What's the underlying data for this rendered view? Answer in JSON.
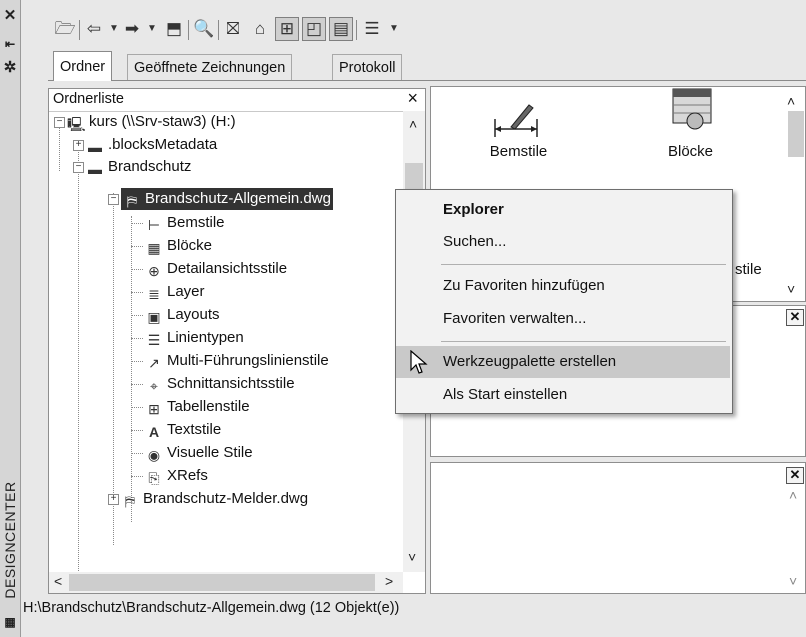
{
  "sidebar": {
    "title": "DESIGNCENTER",
    "icons": [
      "close-icon",
      "auto-hide-icon",
      "properties-icon"
    ]
  },
  "toolbar": {
    "icons": [
      "load-icon",
      "back-icon",
      "back-dropdown-icon",
      "forward-icon",
      "forward-dropdown-icon",
      "up-icon",
      "search-icon",
      "favorites-icon",
      "home-icon",
      "tree-view-toggle-icon",
      "preview-icon",
      "description-icon",
      "views-icon",
      "views-dropdown-icon"
    ]
  },
  "tabs": [
    "Ordner",
    "Geöffnete Zeichnungen",
    "Protokoll"
  ],
  "tree": {
    "header": "Ordnerliste",
    "close": "×",
    "items": [
      {
        "label": "kurs (\\\\Srv-staw3) (H:)",
        "icon": "network-drive-icon"
      },
      {
        "label": ".blocksMetadata",
        "icon": "folder-icon"
      },
      {
        "label": "Brandschutz",
        "icon": "folder-icon"
      },
      {
        "label": "Brandschutz-Allgemein.dwg",
        "icon": "drawing-file-icon"
      },
      {
        "label": "Bemstile",
        "icon": "dimstyle-icon"
      },
      {
        "label": "Blöcke",
        "icon": "blocks-icon"
      },
      {
        "label": "Detailansichtsstile",
        "icon": "detail-view-style-icon"
      },
      {
        "label": "Layer",
        "icon": "layer-icon"
      },
      {
        "label": "Layouts",
        "icon": "layout-icon"
      },
      {
        "label": "Linientypen",
        "icon": "linetype-icon"
      },
      {
        "label": "Multi-Führungslinienstile",
        "icon": "multileader-icon"
      },
      {
        "label": "Schnittansichtsstile",
        "icon": "section-view-style-icon"
      },
      {
        "label": "Tabellenstile",
        "icon": "table-style-icon"
      },
      {
        "label": "Textstile",
        "icon": "text-style-icon"
      },
      {
        "label": "Visuelle Stile",
        "icon": "visual-style-icon"
      },
      {
        "label": "XRefs",
        "icon": "xref-icon"
      },
      {
        "label": "Brandschutz-Melder.dwg",
        "icon": "drawing-file-icon"
      }
    ]
  },
  "preview": {
    "items": [
      {
        "label": "Bemstile",
        "icon": "dimstyle-large-icon"
      },
      {
        "label": "Blöcke",
        "icon": "blocks-large-icon"
      },
      {
        "label": "stile",
        "icon": ""
      }
    ]
  },
  "context_menu": {
    "items": [
      "Explorer",
      "Suchen...",
      "Zu Favoriten hinzufügen",
      "Favoriten verwalten...",
      "Werkzeugpalette erstellen",
      "Als Start einstellen"
    ]
  },
  "status": {
    "path": "H:\\Brandschutz\\Brandschutz-Allgemein.dwg (12 Objekt(e))"
  }
}
